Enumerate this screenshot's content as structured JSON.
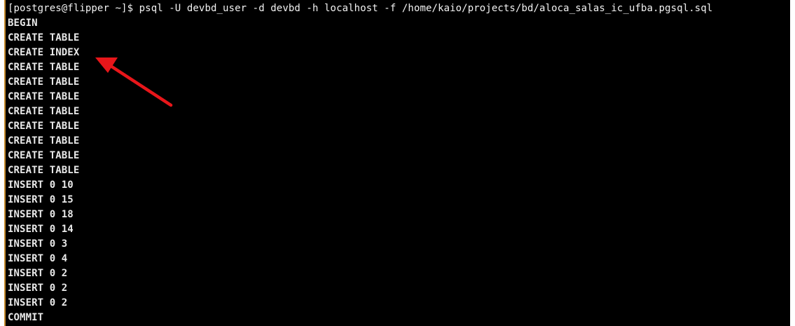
{
  "terminal": {
    "command_line": "[postgres@flipper ~]$ psql -U devbd_user -d devbd -h localhost -f /home/kaio/projects/bd/aloca_salas_ic_ufba.pgsql.sql",
    "output": [
      "BEGIN",
      "CREATE TABLE",
      "CREATE INDEX",
      "CREATE TABLE",
      "CREATE TABLE",
      "CREATE TABLE",
      "CREATE TABLE",
      "CREATE TABLE",
      "CREATE TABLE",
      "CREATE TABLE",
      "CREATE TABLE",
      "INSERT 0 10",
      "INSERT 0 15",
      "INSERT 0 18",
      "INSERT 0 14",
      "INSERT 0 3",
      "INSERT 0 4",
      "INSERT 0 2",
      "INSERT 0 2",
      "INSERT 0 2",
      "COMMIT"
    ]
  },
  "annotation": {
    "arrow_color": "#e8161a",
    "border_color": "#c58a2c"
  }
}
